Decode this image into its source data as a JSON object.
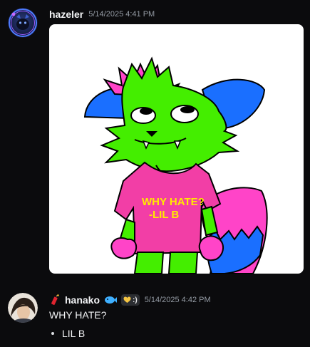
{
  "messages": [
    {
      "username": "hazeler",
      "timestamp": "5/14/2025 4:41 PM",
      "attachment": {
        "shirt_text_line1": "WHY HATE?",
        "shirt_text_line2": "-LIL B"
      }
    },
    {
      "username": "hanako",
      "timestamp": "5/14/2025 4:42 PM",
      "tag": ":)",
      "text": "WHY HATE?",
      "list_items": [
        "LIL B"
      ]
    }
  ],
  "colors": {
    "background": "#0b0b0d",
    "username": "#f2f3f5",
    "timestamp": "#949ba4",
    "text": "#f2f3f5"
  },
  "icons": {
    "hanako_prefix": "firecracker-icon",
    "hanako_badge": "fish-icon",
    "hanako_tag_icon": "heart-hands-icon"
  }
}
